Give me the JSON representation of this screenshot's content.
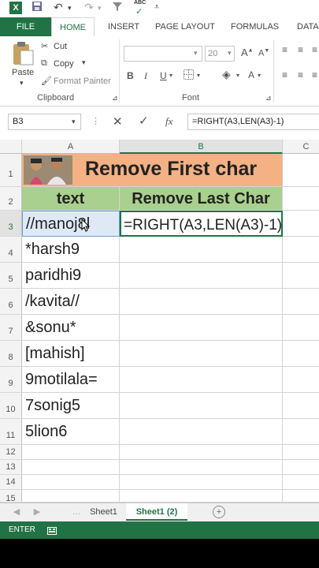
{
  "qat": {
    "app_icon": "X",
    "save_icon": "save-icon",
    "undo_icon": "undo-icon",
    "redo_icon": "redo-icon",
    "filter_icon": "filter-icon",
    "spell_label": "ABC"
  },
  "tabs": [
    "FILE",
    "HOME",
    "INSERT",
    "PAGE LAYOUT",
    "FORMULAS",
    "DATA"
  ],
  "ribbon": {
    "cut": "Cut",
    "copy": "Copy",
    "paste": "Paste",
    "format_painter": "Format Painter",
    "clipboard_label": "Clipboard",
    "font_label": "Font",
    "font_size": "20"
  },
  "formula_bar": {
    "name_box": "B3",
    "formula": "=RIGHT(A3,LEN(A3)-1)"
  },
  "sheet": {
    "columns": [
      "A",
      "B",
      "C"
    ],
    "title": "Remove First char",
    "header_a": "text",
    "header_b": "Remove Last Char",
    "rows": [
      "1",
      "2",
      "3",
      "4",
      "5",
      "6",
      "7",
      "8",
      "9",
      "10",
      "11",
      "12",
      "13",
      "14",
      "15"
    ],
    "values_a": [
      "//manoj8l",
      "*harsh9",
      "paridhi9",
      "/kavita//",
      "&sonu*",
      "[mahish]",
      "9motilala=",
      "7sonig5",
      "5lion6"
    ],
    "b3_value": "=RIGHT(A3,LEN(A3)-1)"
  },
  "sheet_tabs": [
    "Sheet1",
    "Sheet1 (2)"
  ],
  "status": {
    "mode": "ENTER"
  },
  "colors": {
    "excel_green": "#217346",
    "title_orange": "#f4b183",
    "header_green": "#a9d08e"
  }
}
